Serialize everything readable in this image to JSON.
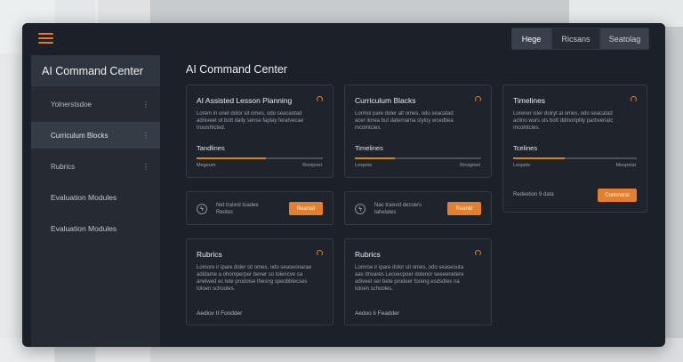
{
  "window": {
    "menu_icon": "hamburger-icon",
    "top_tabs": [
      "Hege",
      "Ricsans",
      "Seatolag"
    ],
    "accent": "#e07b28"
  },
  "sidebar": {
    "title": "AI Command Center",
    "items": [
      {
        "label": "Yolnerstsdoe",
        "chevron": "⋮"
      },
      {
        "label": "Curriculum Blocks",
        "chevron": "⋮"
      },
      {
        "label": "Rubrics",
        "chevron": "⋮"
      },
      {
        "label": "Evaluation Modules",
        "chevron": ""
      },
      {
        "label": "Evaluation Modules",
        "chevron": ""
      }
    ]
  },
  "main": {
    "title": "AI Command Center",
    "cards": [
      {
        "title": "AI Assisted Lesson Planning",
        "body": [
          "Lorem in unet dolor sit omes, odo seacaotad",
          "adniveet ut bott daily sense faplay feratvecae",
          "trouishlcted."
        ],
        "sub": "Tandlines",
        "progress": 0.55,
        "meta_left": "Megeum",
        "meta_right": "Resipnet"
      },
      {
        "title": "Curriculum Blacks",
        "body": [
          "Lormoi pare doler alt omes, odo seacatad",
          "acer ilorea but daternama styloy wcedtiea",
          "mcolntcies."
        ],
        "sub": "Timelines",
        "progress": 0.32,
        "meta_left": "Lespeie",
        "meta_right": "Resiginet"
      },
      {
        "title": "Timelines",
        "body": [
          "Lorener isler doiryt ai omes, odo seacatad",
          "aclino wurs uls bott ddinoriplily parbveriatc",
          "mcolntcies."
        ],
        "sub": "Tcelines",
        "progress": 0.42,
        "meta_left": "Lespeie",
        "meta_right": "Mespeiat"
      }
    ],
    "actions": [
      {
        "icon": "lightning-icon",
        "glyph": "ϟ",
        "line1": "Net traixrd toadee",
        "line2": "Reotes",
        "button": "Reansd"
      },
      {
        "icon": "lightning-icon",
        "glyph": "ϟ",
        "line1": "Nac traixvd decoers",
        "line2": "tahelates",
        "button": "Reanid"
      }
    ],
    "side_action": {
      "label": "Redeetion 9 data",
      "button": "Connnorai"
    },
    "bottom_cards": [
      {
        "title": "Rubrics",
        "body": [
          "Lomore ir ipare doler sit omes, odo seaseonarae",
          "adidame a ohomperper bener so tolencve sa",
          "anelwed ec lete prodoise thesng speobblecses",
          "toloen schooles."
        ],
        "footer": "Aediov II Fondder"
      },
      {
        "title": "Rubrics",
        "body": [
          "Lomroe ir ipare dolor sit omes, odo seaseouta",
          "aas dnvares Lecoecpoer dolenor seeeenetere",
          "adiveet ser bete prodeer foreng esdsdtes na",
          "loloen schooles."
        ],
        "footer": "Aedoo Ii Feadder"
      }
    ]
  }
}
